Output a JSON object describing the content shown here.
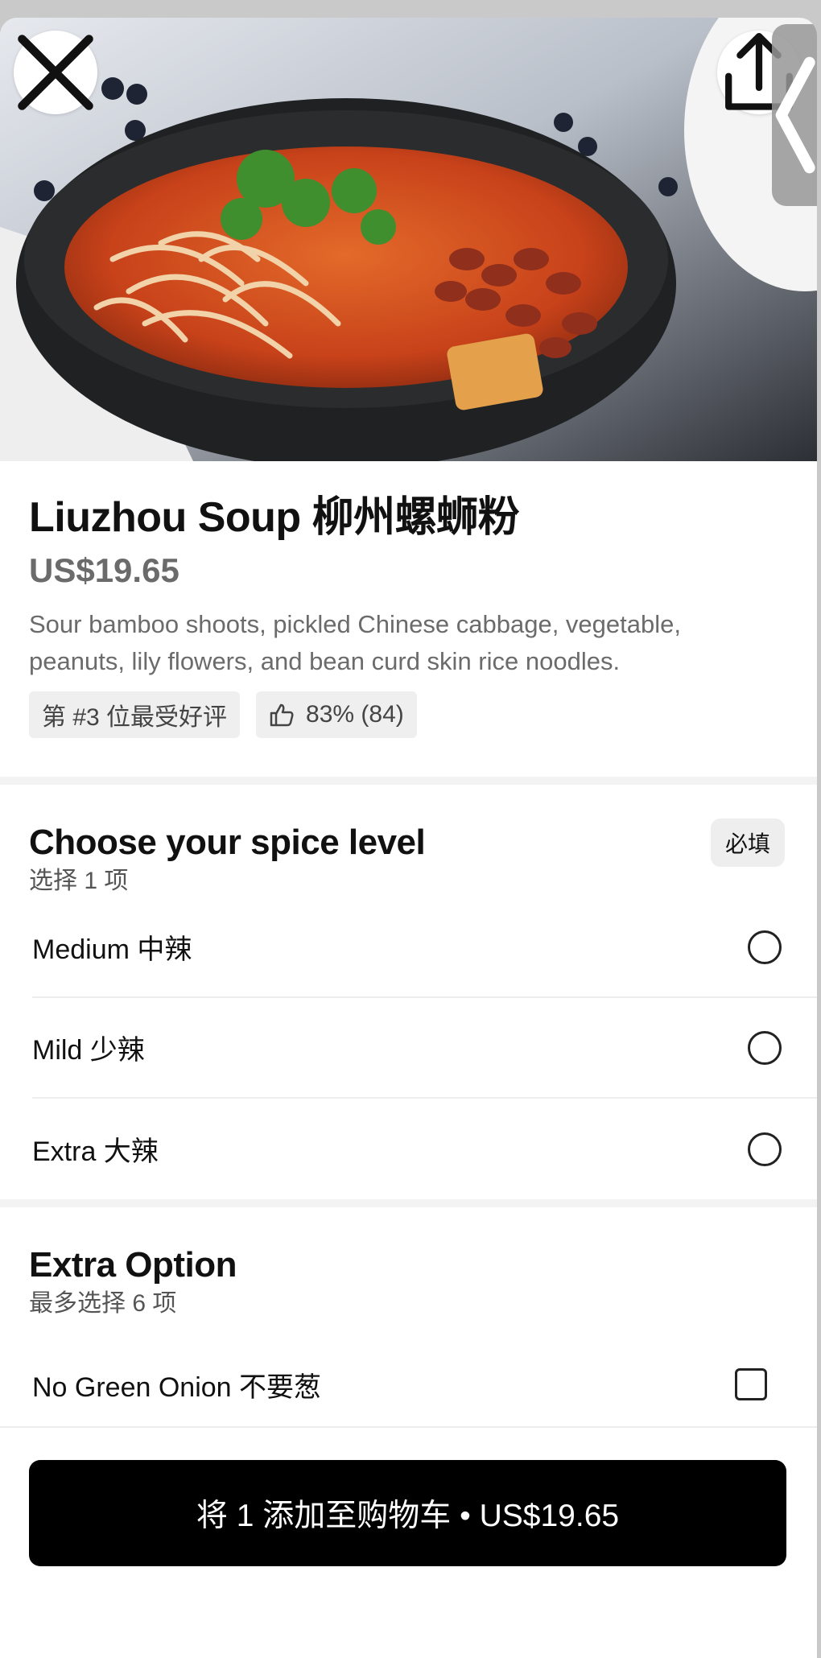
{
  "header": {
    "close_icon": "close-icon",
    "share_icon": "share-icon",
    "side_tab_icon": "chevron-left-icon"
  },
  "item": {
    "title": "Liuzhou Soup 柳州螺蛳粉",
    "price": "US$19.65",
    "description": "Sour bamboo shoots, pickled Chinese cabbage, vegetable, peanuts, lily flowers, and bean curd skin rice noodles.",
    "rank_badge": "第 #3 位最受好评",
    "rating_badge": "83% (84)"
  },
  "spice_group": {
    "title": "Choose your spice level",
    "subtitle": "选择 1 项",
    "required_label": "必填",
    "options": [
      {
        "label": "Medium 中辣"
      },
      {
        "label": "Mild 少辣"
      },
      {
        "label": "Extra 大辣"
      }
    ]
  },
  "extra_group": {
    "title": "Extra Option",
    "subtitle": "最多选择 6 项",
    "options": [
      {
        "label": "No Green Onion 不要葱"
      }
    ]
  },
  "footer": {
    "add_to_cart_label": "将 1 添加至购物车 • US$19.65"
  },
  "colors": {
    "accent": "#000000",
    "muted_text": "#6b6b6b",
    "badge_bg": "#efefef"
  }
}
